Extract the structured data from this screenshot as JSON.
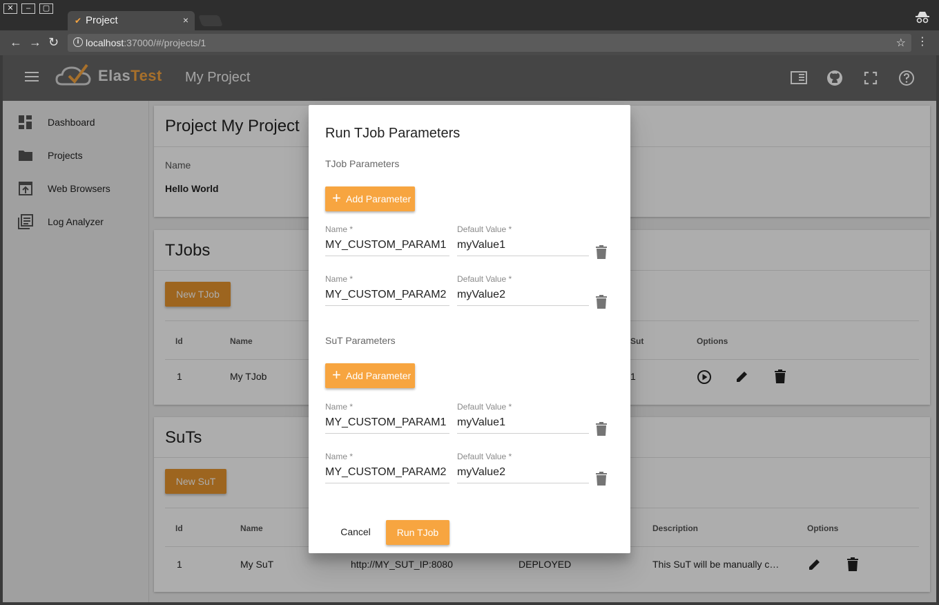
{
  "browser": {
    "tab_title": "Project",
    "tab_close": "×",
    "url_host": "localhost",
    "url_rest": ":37000/#/projects/1"
  },
  "app": {
    "brand_part1": "Elas",
    "brand_part2": "Test",
    "page_title": "My Project",
    "accent_color": "#f7a540",
    "toolbar_color": "#666666"
  },
  "sidebar": {
    "items": [
      {
        "label": "Dashboard",
        "icon": "dashboard-icon"
      },
      {
        "label": "Projects",
        "icon": "folder-icon"
      },
      {
        "label": "Web Browsers",
        "icon": "web-browser-icon"
      },
      {
        "label": "Log Analyzer",
        "icon": "log-analyzer-icon"
      }
    ]
  },
  "project_card": {
    "title": "Project My Project",
    "name_label": "Name",
    "name_value": "Hello World"
  },
  "tjobs_card": {
    "title": "TJobs",
    "new_button": "New TJob",
    "headers": [
      "Id",
      "Name",
      "Sut",
      "Options"
    ],
    "rows": [
      {
        "id": "1",
        "name": "My TJob",
        "sut": "1"
      }
    ]
  },
  "suts_card": {
    "title": "SuTs",
    "new_button": "New SuT",
    "headers": [
      "Id",
      "Name",
      "Description",
      "Options"
    ],
    "rows": [
      {
        "id": "1",
        "name": "My SuT",
        "url": "http://MY_SUT_IP:8080",
        "status": "DEPLOYED",
        "description": "This SuT will be manually c…"
      }
    ]
  },
  "dialog": {
    "title": "Run TJob Parameters",
    "tjob_section": "TJob Parameters",
    "sut_section": "SuT Parameters",
    "add_parameter": "Add Parameter",
    "name_label": "Name *",
    "value_label": "Default Value *",
    "tjob_params": [
      {
        "name": "MY_CUSTOM_PARAM1",
        "value": "myValue1"
      },
      {
        "name": "MY_CUSTOM_PARAM2",
        "value": "myValue2"
      }
    ],
    "sut_params": [
      {
        "name": "MY_CUSTOM_PARAM1",
        "value": "myValue1"
      },
      {
        "name": "MY_CUSTOM_PARAM2",
        "value": "myValue2"
      }
    ],
    "cancel": "Cancel",
    "run": "Run TJob"
  }
}
